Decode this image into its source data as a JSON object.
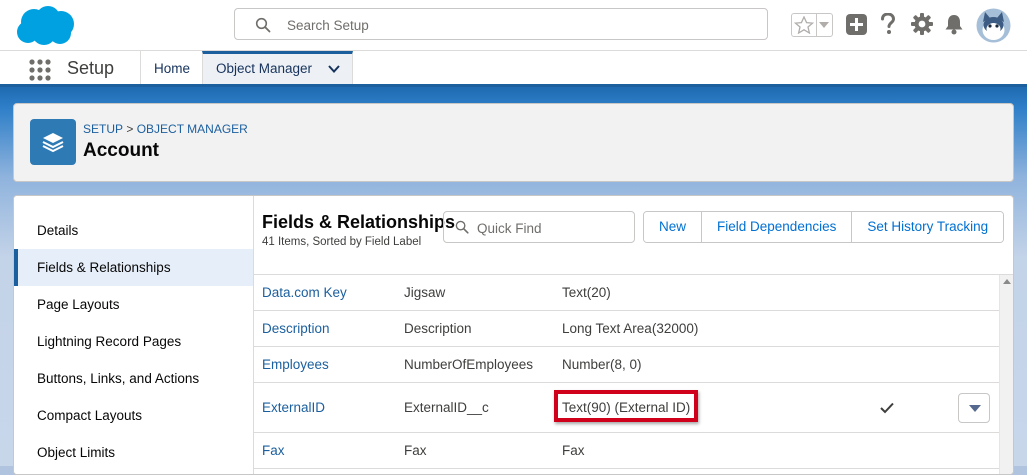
{
  "header": {
    "search_placeholder": "Search Setup",
    "icons": [
      "salesforce-logo",
      "search-icon",
      "favorites-star-icon",
      "favorites-dropdown-icon",
      "global-add-icon",
      "help-icon",
      "setup-gear-icon",
      "notifications-bell-icon",
      "user-avatar"
    ]
  },
  "nav": {
    "app_name": "Setup",
    "tabs": [
      {
        "label": "Home"
      },
      {
        "label": "Object Manager"
      }
    ]
  },
  "object_header": {
    "breadcrumb": [
      "SETUP",
      ">",
      "OBJECT MANAGER"
    ],
    "title": "Account"
  },
  "sidebar": {
    "items": [
      {
        "label": "Details"
      },
      {
        "label": "Fields & Relationships"
      },
      {
        "label": "Page Layouts"
      },
      {
        "label": "Lightning Record Pages"
      },
      {
        "label": "Buttons, Links, and Actions"
      },
      {
        "label": "Compact Layouts"
      },
      {
        "label": "Object Limits"
      }
    ],
    "active_item": "Fields & Relationships"
  },
  "fields_section": {
    "title": "Fields & Relationships",
    "subtitle": "41 Items, Sorted by Field Label",
    "quick_find_placeholder": "Quick Find",
    "buttons": [
      "New",
      "Field Dependencies",
      "Set History Tracking"
    ],
    "rows": [
      {
        "label": "Data.com Key",
        "api_name": "Jigsaw",
        "type": "Text(20)"
      },
      {
        "label": "Description",
        "api_name": "Description",
        "type": "Long Text Area(32000)"
      },
      {
        "label": "Employees",
        "api_name": "NumberOfEmployees",
        "type": "Number(8, 0)"
      },
      {
        "label": "ExternalID",
        "api_name": "ExternalID__c",
        "type": "Text(90) (External ID)",
        "indexed": true,
        "highlighted": true
      },
      {
        "label": "Fax",
        "api_name": "Fax",
        "type": "Fax"
      }
    ]
  },
  "colors": {
    "brand_blue": "#1b5f9e",
    "link_blue": "#0070d2",
    "object_icon": "#2e7ab4",
    "highlight_red": "#d0021b"
  }
}
